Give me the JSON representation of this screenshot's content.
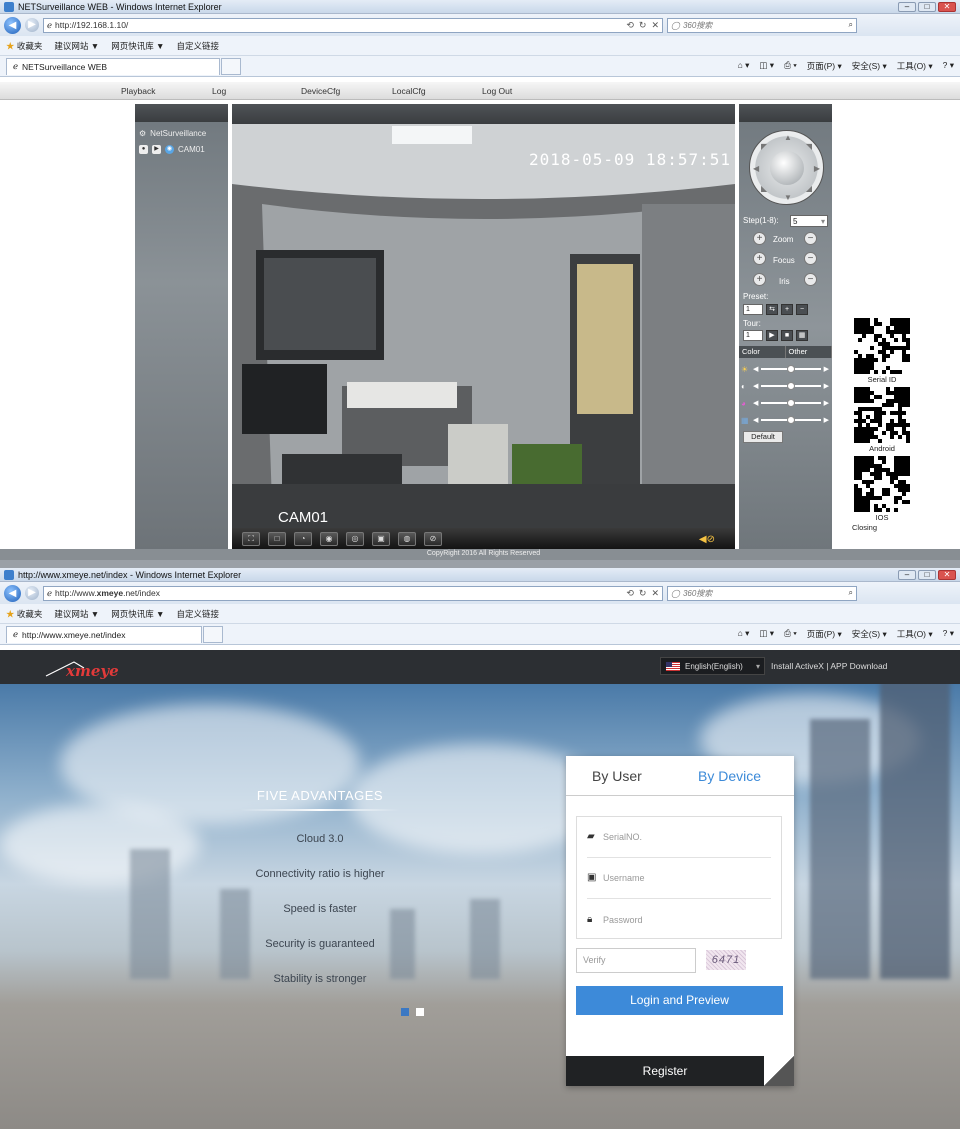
{
  "window1": {
    "title": "NETSurveillance WEB - Windows Internet Explorer",
    "address": "http://192.168.1.10/",
    "search_placeholder": "360搜索",
    "fav_label": "收藏夹",
    "fav_links": [
      "建议网站 ▼",
      "网页快讯库 ▼",
      "自定义链接"
    ],
    "tab_title": "NETSurveillance WEB",
    "cmd_items": [
      "页面(P) ▾",
      "安全(S) ▾",
      "工具(O) ▾"
    ],
    "menu": [
      "Playback",
      "Log",
      "DeviceCfg",
      "LocalCfg",
      "Log Out"
    ],
    "tree_root": "NetSurveillance",
    "tree_channel": "CAM01",
    "video_timestamp": "2018-05-09 18:57:51",
    "video_cam_label": "CAM01",
    "ptz": {
      "step_label": "Step(1-8):",
      "step_value": "5",
      "zoom": "Zoom",
      "focus": "Focus",
      "iris": "Iris",
      "preset_label": "Preset:",
      "preset_value": "1",
      "tour_label": "Tour:",
      "tour_value": "1",
      "tab_color": "Color",
      "tab_other": "Other",
      "default_button": "Default",
      "slider_levels": [
        0.5,
        0.5,
        0.5,
        0.5
      ]
    },
    "qr_labels": [
      "Serial ID",
      "Android",
      "IOS"
    ],
    "closing": "Closing",
    "copyright": "CopyRight 2016 All Rights Reserved"
  },
  "window2": {
    "title": "http://www.xmeye.net/index - Windows Internet Explorer",
    "address_prefix": "http://www.",
    "address_bold": "xmeye",
    "address_suffix": ".net/index",
    "search_placeholder": "360搜索",
    "fav_label": "收藏夹",
    "fav_links": [
      "建议网站 ▼",
      "网页快讯库 ▼",
      "自定义链接"
    ],
    "tab_title": "http://www.xmeye.net/index",
    "cmd_items": [
      "页面(P) ▾",
      "安全(S) ▾",
      "工具(O) ▾"
    ],
    "logo_text": "xmeye",
    "language": "English(English)",
    "header_links": "Install ActiveX | APP Download",
    "advantages_title": "FIVE ADVANTAGES",
    "advantages": [
      "Cloud 3.0",
      "Connectivity ratio is higher",
      "Speed is faster",
      "Security is guaranteed",
      "Stability is stronger"
    ],
    "login": {
      "tab_user": "By User",
      "tab_device": "By Device",
      "serial_placeholder": "SerialNO.",
      "username_placeholder": "Username",
      "password_placeholder": "Password",
      "verify_placeholder": "Verify",
      "captcha": "6471",
      "login_button": "Login and Preview",
      "register_button": "Register"
    }
  }
}
